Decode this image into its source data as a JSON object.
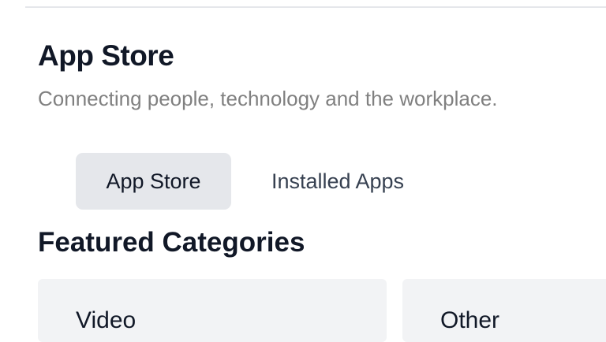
{
  "header": {
    "title": "App Store",
    "subtitle": "Connecting people, technology and the workplace."
  },
  "tabs": [
    {
      "label": "App Store",
      "selected": true
    },
    {
      "label": "Installed Apps",
      "selected": false
    }
  ],
  "featured": {
    "heading": "Featured Categories",
    "categories": [
      {
        "label": "Video"
      },
      {
        "label": "Other"
      }
    ]
  },
  "colors": {
    "text_primary": "#111827",
    "text_muted": "#808080",
    "tab_selected_bg": "#e5e7eb",
    "card_bg": "#f2f3f5"
  }
}
